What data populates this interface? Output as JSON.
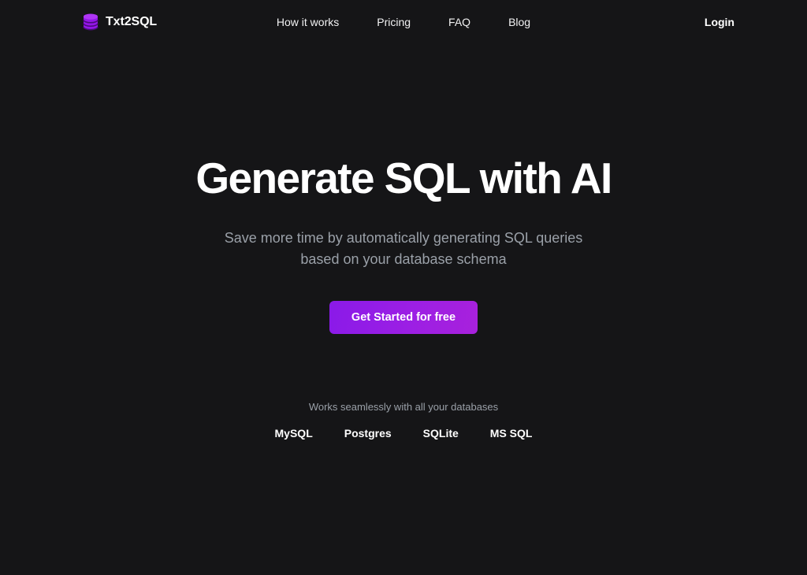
{
  "theme": {
    "background": "#151517",
    "text_primary": "#ffffff",
    "text_muted": "#9aa0a8",
    "accent_purple_start": "#8A1AE8",
    "accent_purple_end": "#A821DC",
    "logo_purple": "#A020F0"
  },
  "header": {
    "logo_icon": "database-cylinder-icon",
    "brand_name": "Txt2SQL",
    "nav": [
      {
        "label": "How it works"
      },
      {
        "label": "Pricing"
      },
      {
        "label": "FAQ"
      },
      {
        "label": "Blog"
      }
    ],
    "login_label": "Login"
  },
  "hero": {
    "title": "Generate SQL with AI",
    "subtitle_line1": "Save more time by automatically generating SQL queries",
    "subtitle_line2": "based on your database schema",
    "cta_label": "Get Started for free"
  },
  "databases": {
    "caption": "Works seamlessly with all your databases",
    "items": [
      {
        "label": "MySQL"
      },
      {
        "label": "Postgres"
      },
      {
        "label": "SQLite"
      },
      {
        "label": "MS SQL"
      }
    ]
  }
}
